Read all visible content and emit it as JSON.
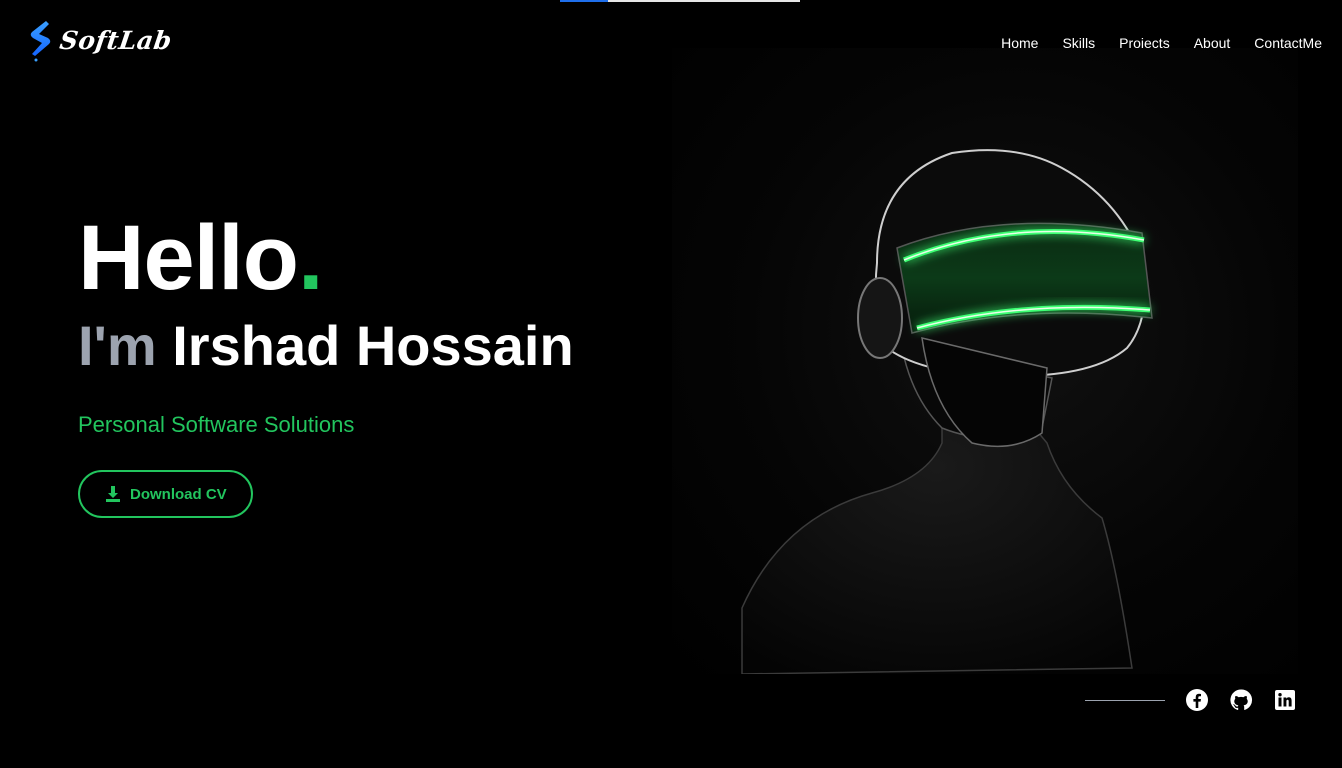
{
  "brand": {
    "name": "SoftLab",
    "accent": "#22c55e",
    "logo_color": "#1e90ff"
  },
  "nav": {
    "items": [
      {
        "label": "Home"
      },
      {
        "label": "Skills"
      },
      {
        "label": "Projects"
      },
      {
        "label": "About"
      },
      {
        "label": "ContactMe"
      }
    ]
  },
  "hero": {
    "greeting": "Hello",
    "greeting_dot": ".",
    "im": "I'm",
    "name": "Irshad Hossain",
    "tagline": "Personal Software Solutions",
    "cv_button": "Download CV",
    "image_icon": "vr-headset-portrait"
  },
  "socials": [
    {
      "icon": "facebook-icon"
    },
    {
      "icon": "github-icon"
    },
    {
      "icon": "linkedin-icon"
    }
  ],
  "scroll_progress": 0.2
}
